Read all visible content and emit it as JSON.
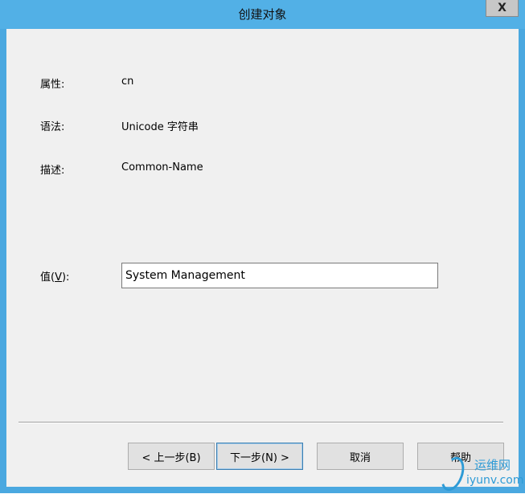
{
  "window": {
    "title": "创建对象",
    "close_glyph": "X"
  },
  "fields": {
    "attribute_label": "属性:",
    "attribute_value": "cn",
    "syntax_label": "语法:",
    "syntax_value": "Unicode 字符串",
    "description_label": "描述:",
    "description_value": "Common-Name"
  },
  "value_field": {
    "label_prefix": "值(",
    "label_accel": "V",
    "label_suffix": "):",
    "current_value": "System Management"
  },
  "buttons": {
    "back": "< 上一步(B)",
    "next": "下一步(N) >",
    "cancel": "取消",
    "help": "帮助"
  },
  "watermark": {
    "line1": "运维网",
    "line2": "iyunv.com"
  },
  "colors": {
    "titlebar": "#52b0e6",
    "client": "#f0f0f0",
    "watermark": "#2e9bd6"
  }
}
